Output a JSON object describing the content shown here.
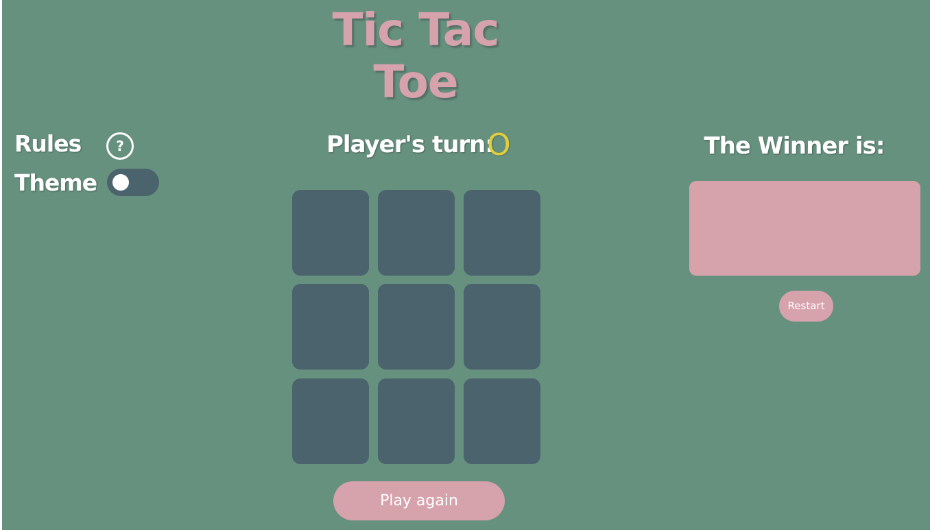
{
  "title": "Tic Tac Toe",
  "sidebar": {
    "rules_label": "Rules",
    "help_glyph": "?",
    "theme_label": "Theme",
    "theme_toggle_on": false
  },
  "turn": {
    "label": "Player's turn:",
    "current_player": "O"
  },
  "board": {
    "cells": [
      "",
      "",
      "",
      "",
      "",
      "",
      "",
      "",
      ""
    ]
  },
  "play_again_label": "Play again",
  "winner": {
    "label": "The Winner is:",
    "value": ""
  },
  "restart_label": "Restart",
  "colors": {
    "background": "#67917f",
    "accent_pink": "#d6a2ac",
    "cell": "#4a636d",
    "player_o": "#e0cf3c"
  }
}
